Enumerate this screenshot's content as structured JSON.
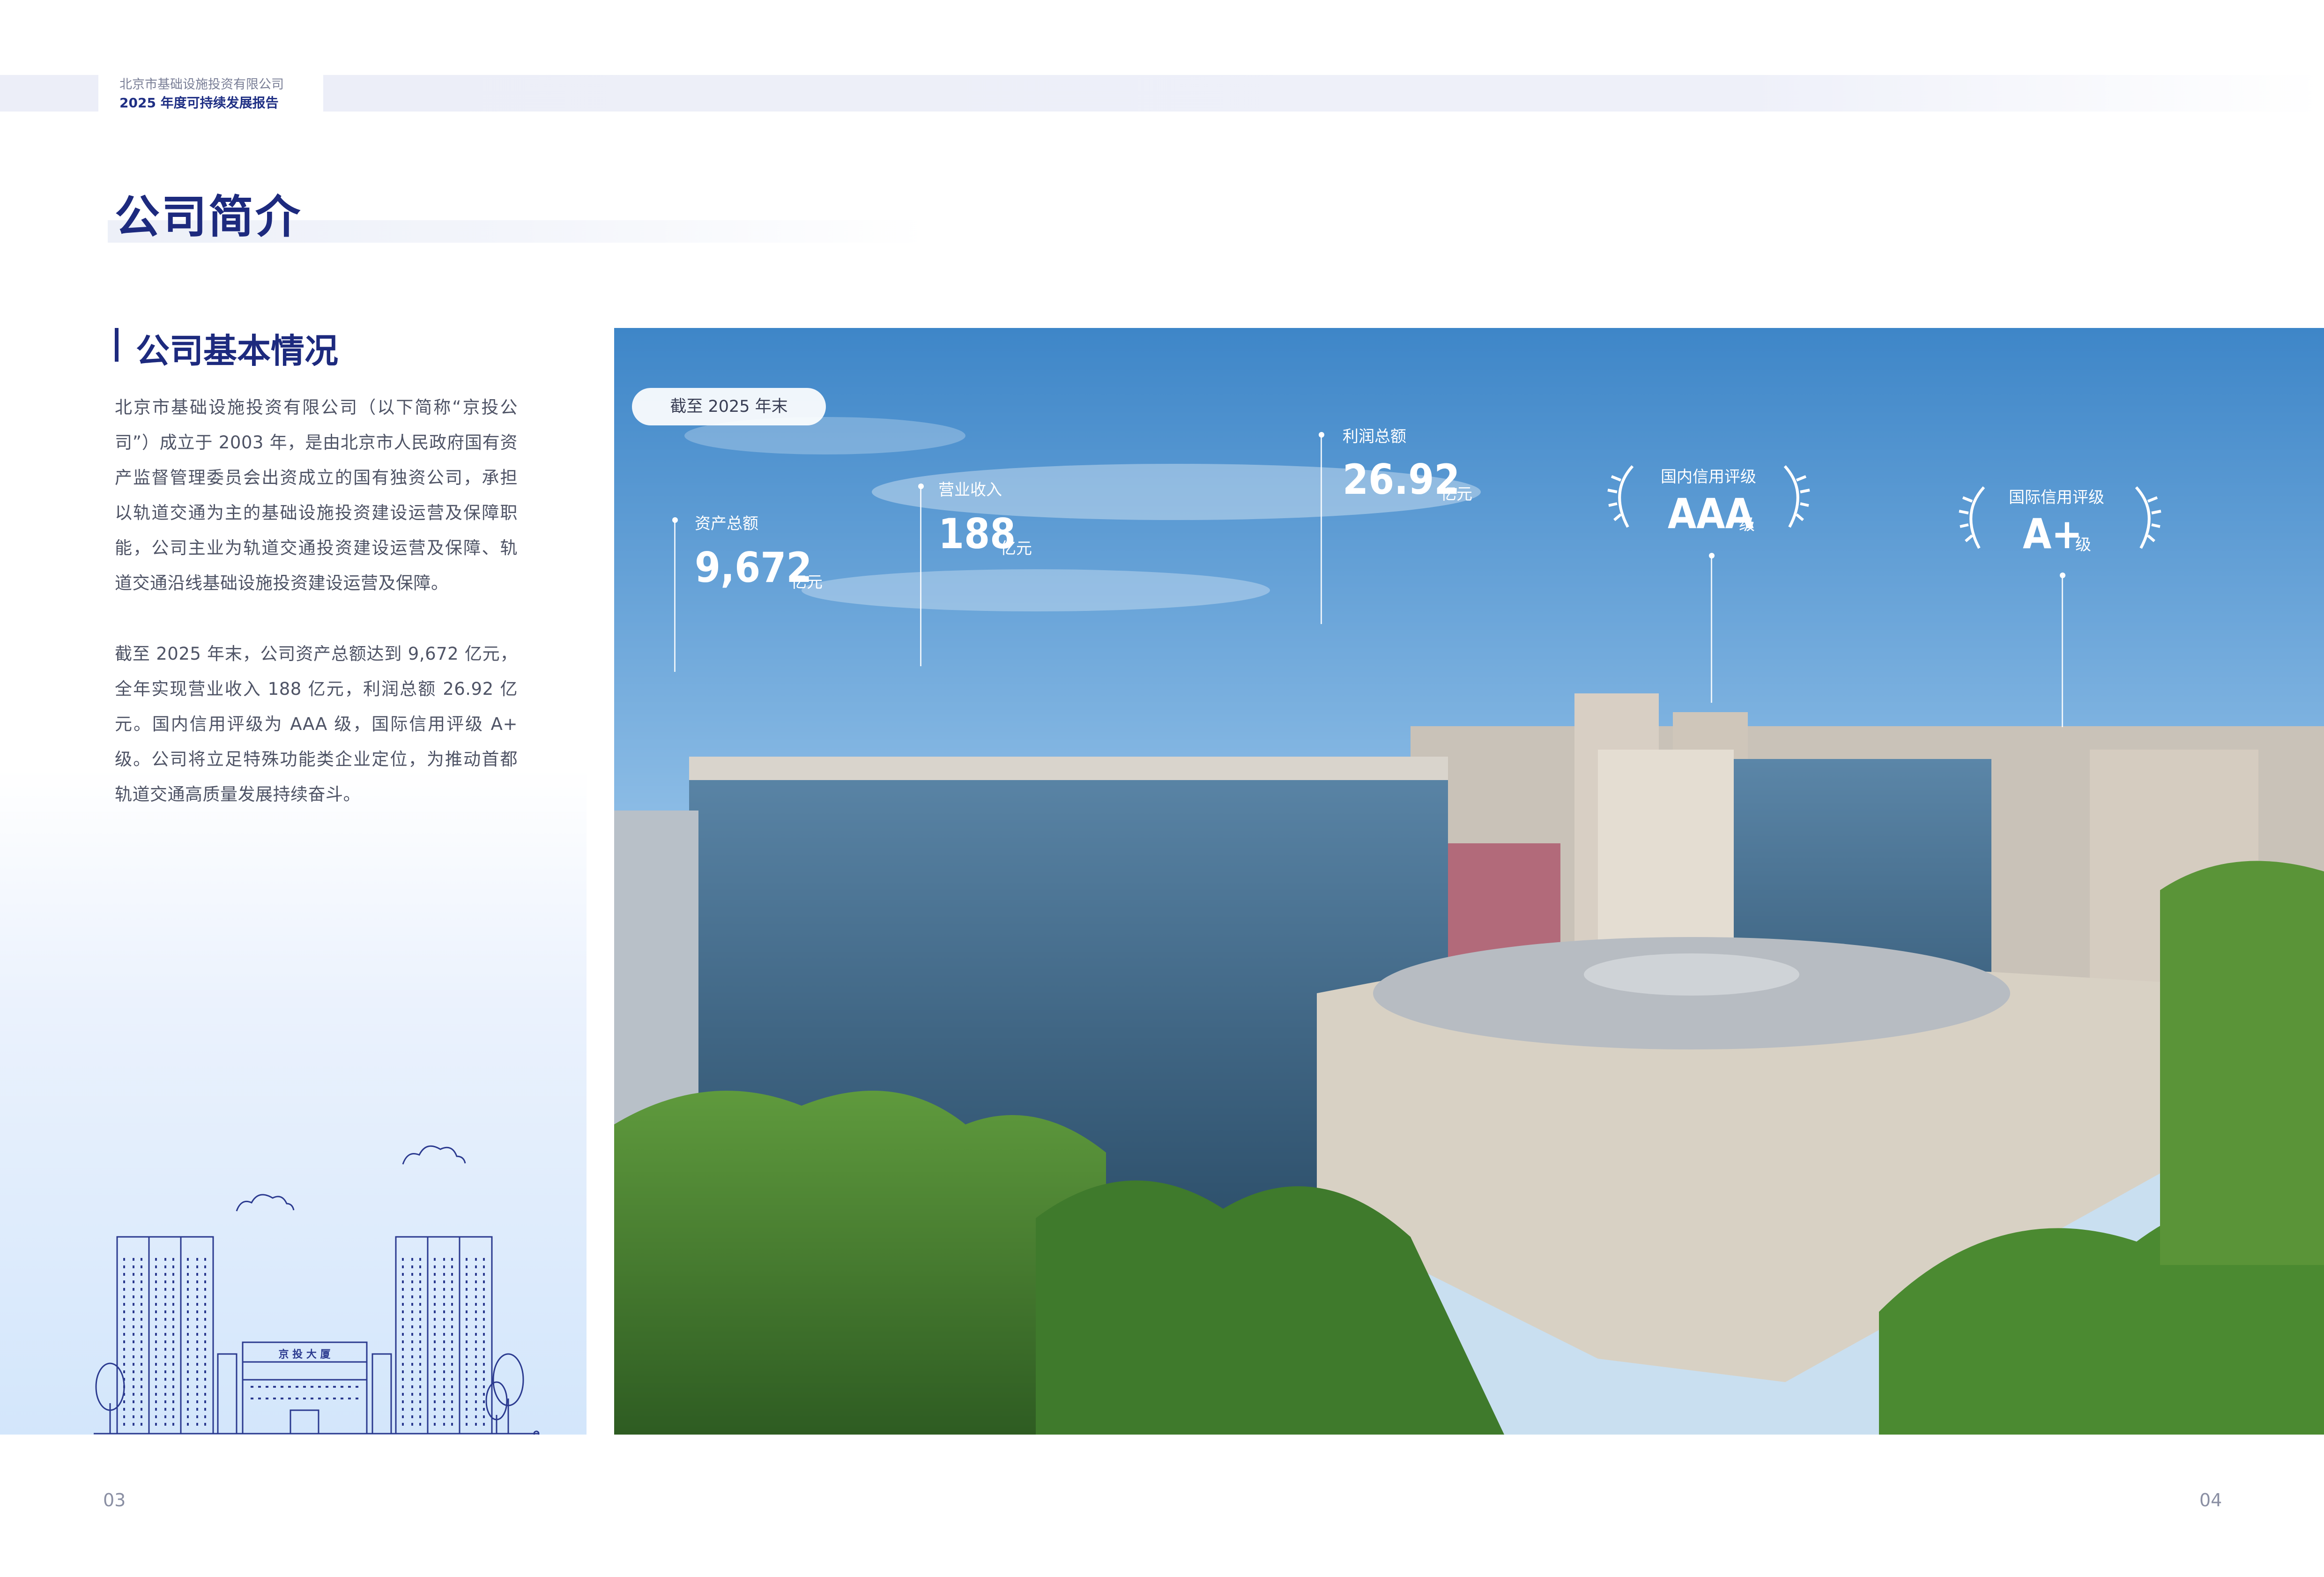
{
  "header": {
    "company": "北京市基础设施投资有限公司",
    "report": "2025 年度可持续发展报告"
  },
  "page_title": "公司简介",
  "section": {
    "title": "公司基本情况",
    "paragraph_1": "北京市基础设施投资有限公司（以下简称“京投公司”）成立于 2003 年，是由北京市人民政府国有资产监督管理委员会出资成立的国有独资公司，承担以轨道交通为主的基础设施投资建设运营及保障职能，公司主业为轨道交通投资建设运营及保障、轨道交通沿线基础设施投资建设运营及保障。",
    "paragraph_2": "截至 2025 年末，公司资产总额达到 9,672 亿元，全年实现营业收入 188 亿元，利润总额 26.92 亿元。国内信用评级为 AAA 级，国际信用评级 A+ 级。公司将立足特殊功能类企业定位，为推动首都轨道交通高质量发展持续奋斗。"
  },
  "illustration": {
    "building_sign": "京 投 大 厦"
  },
  "photo": {
    "date_pill": "截至 2025 年末",
    "stats": {
      "assets": {
        "label": "资产总额",
        "value": "9,672",
        "unit": "亿元"
      },
      "revenue": {
        "label": "营业收入",
        "value": "188",
        "unit": "亿元"
      },
      "profit": {
        "label": "利润总额",
        "value": "26.92",
        "unit": "亿元"
      },
      "domestic_rating": {
        "label": "国内信用评级",
        "value": "AAA",
        "unit": "级"
      },
      "intl_rating": {
        "label": "国际信用评级",
        "value": "A+",
        "unit": "级"
      }
    }
  },
  "page_numbers": {
    "left": "03",
    "right": "04"
  },
  "colors": {
    "brand_navy": "#1d2a7e",
    "text_gray": "#4f5466",
    "illustration_blue": "#2b3a8f"
  }
}
